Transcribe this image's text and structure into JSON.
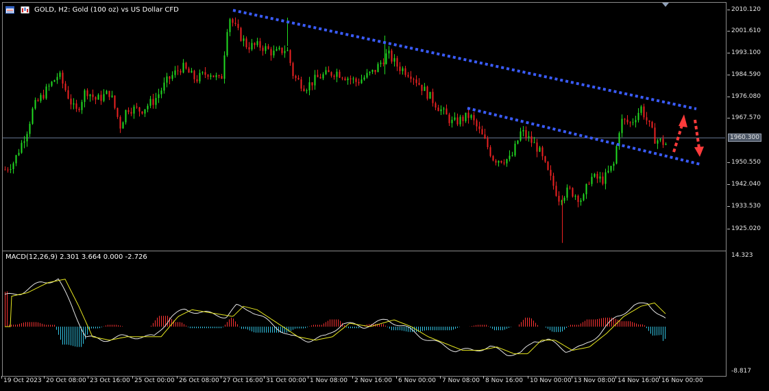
{
  "header": {
    "title": "GOLD, H2:  Gold (100 oz) vs US Dollar CFD"
  },
  "price_axis": {
    "labels": [
      "2010.120",
      "2001.610",
      "1993.100",
      "1984.590",
      "1976.080",
      "1967.570",
      "1950.550",
      "1942.040",
      "1933.530",
      "1925.020"
    ],
    "current_price": "1960.300"
  },
  "macd": {
    "title": "MACD(12,26,9) 2.301 3.664 0.000 -2.726",
    "axis_top": "14.323",
    "axis_bottom": "-8.817"
  },
  "date_axis": {
    "labels": [
      "19 Oct 2023",
      "20 Oct 08:00",
      "23 Oct 16:00",
      "25 Oct 00:00",
      "26 Oct 08:00",
      "27 Oct 16:00",
      "31 Oct 00:00",
      "1 Nov 08:00",
      "2 Nov 16:00",
      "6 Nov 00:00",
      "7 Nov 08:00",
      "8 Nov 16:00",
      "10 Nov 00:00",
      "13 Nov 08:00",
      "14 Nov 16:00",
      "16 Nov 00:00"
    ]
  },
  "colors": {
    "bull": "#22dd22",
    "bear": "#ee2222",
    "channel": "#3a5cff",
    "arrow": "#ff3b3b",
    "macd_hist_pos": "#ff3333",
    "macd_hist_neg": "#33c6e6",
    "macd_line": "#e8e8e8",
    "signal_line": "#e8e820"
  },
  "icons": [
    "chart-window-icon",
    "candles-icon"
  ]
}
